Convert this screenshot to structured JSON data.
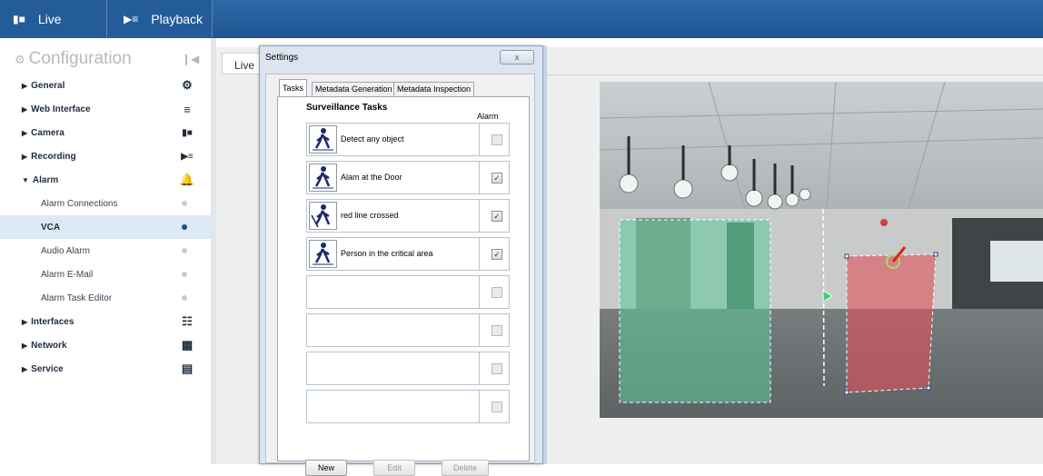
{
  "topbar": {
    "live_label": "Live",
    "playback_label": "Playback"
  },
  "sidebar": {
    "title": "Configuration",
    "items": [
      {
        "label": "General",
        "icon": "gear-icon",
        "expanded": false
      },
      {
        "label": "Web Interface",
        "icon": "menu-icon",
        "expanded": false
      },
      {
        "label": "Camera",
        "icon": "camera-icon",
        "expanded": false
      },
      {
        "label": "Recording",
        "icon": "recording-icon",
        "expanded": false
      },
      {
        "label": "Alarm",
        "icon": "bell-icon",
        "expanded": true
      },
      {
        "label": "Interfaces",
        "icon": "interfaces-icon",
        "expanded": false
      },
      {
        "label": "Network",
        "icon": "network-icon",
        "expanded": false
      },
      {
        "label": "Service",
        "icon": "service-icon",
        "expanded": false
      }
    ],
    "alarm_subitems": [
      {
        "label": "Alarm Connections",
        "active": false
      },
      {
        "label": "VCA",
        "active": true
      },
      {
        "label": "Audio Alarm",
        "active": false
      },
      {
        "label": "Alarm E-Mail",
        "active": false
      },
      {
        "label": "Alarm Task Editor",
        "active": false
      }
    ]
  },
  "main": {
    "live_tab": "Live"
  },
  "dialog": {
    "title": "Settings",
    "close_label": "x",
    "tabs": [
      "Tasks",
      "Metadata Generation",
      "Metadata Inspection"
    ],
    "panel_title": "Surveillance Tasks",
    "alarm_header": "Alarm",
    "tasks": [
      {
        "label": "Detect any object",
        "alarm": false
      },
      {
        "label": "Alam at the Door",
        "alarm": true
      },
      {
        "label": "red line crossed",
        "alarm": true
      },
      {
        "label": "Person in the critical area",
        "alarm": true
      },
      {
        "label": "",
        "alarm": false
      },
      {
        "label": "",
        "alarm": false
      },
      {
        "label": "",
        "alarm": false
      },
      {
        "label": "",
        "alarm": false
      }
    ],
    "buttons": {
      "new": "New",
      "edit": "Edit",
      "delete": "Delete"
    }
  },
  "colors": {
    "topbar": "#245c9a",
    "active_nav": "#dde9f5",
    "green_zone": "#5fc79a",
    "red_zone": "#e0505a"
  }
}
